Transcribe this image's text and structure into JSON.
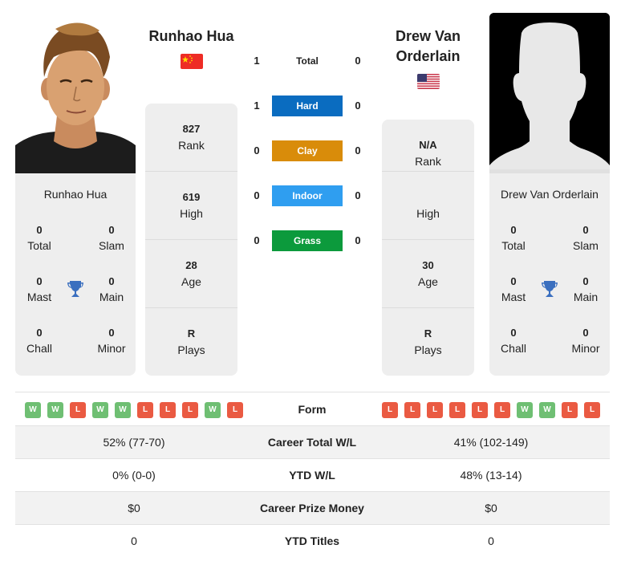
{
  "player1": {
    "name": "Runhao Hua",
    "country_flag": "china-flag",
    "photo": "player-photo",
    "card_name": "Runhao Hua",
    "titles": {
      "total": {
        "value": "0",
        "label": "Total"
      },
      "slam": {
        "value": "0",
        "label": "Slam"
      },
      "mast": {
        "value": "0",
        "label": "Mast"
      },
      "main": {
        "value": "0",
        "label": "Main"
      },
      "chall": {
        "value": "0",
        "label": "Chall"
      },
      "minor": {
        "value": "0",
        "label": "Minor"
      }
    },
    "stats": {
      "rank": {
        "value": "827",
        "label": "Rank"
      },
      "high": {
        "value": "619",
        "label": "High"
      },
      "age": {
        "value": "28",
        "label": "Age"
      },
      "plays": {
        "value": "R",
        "label": "Plays"
      }
    },
    "form": [
      "W",
      "W",
      "L",
      "W",
      "W",
      "L",
      "L",
      "L",
      "W",
      "L"
    ]
  },
  "player2": {
    "name": "Drew Van Orderlain",
    "country_flag": "usa-flag",
    "photo": "silhouette-placeholder",
    "card_name": "Drew Van Orderlain",
    "titles": {
      "total": {
        "value": "0",
        "label": "Total"
      },
      "slam": {
        "value": "0",
        "label": "Slam"
      },
      "mast": {
        "value": "0",
        "label": "Mast"
      },
      "main": {
        "value": "0",
        "label": "Main"
      },
      "chall": {
        "value": "0",
        "label": "Chall"
      },
      "minor": {
        "value": "0",
        "label": "Minor"
      }
    },
    "stats": {
      "rank": {
        "value": "N/A",
        "label": "Rank"
      },
      "high": {
        "value": "",
        "label": "High"
      },
      "age": {
        "value": "30",
        "label": "Age"
      },
      "plays": {
        "value": "R",
        "label": "Plays"
      }
    },
    "form": [
      "L",
      "L",
      "L",
      "L",
      "L",
      "L",
      "W",
      "W",
      "L",
      "L"
    ]
  },
  "h2h": {
    "total": {
      "label": "Total",
      "p1": "1",
      "p2": "0"
    },
    "surfaces": [
      {
        "label": "Hard",
        "p1": "1",
        "p2": "0",
        "color": "#0a6cc0"
      },
      {
        "label": "Clay",
        "p1": "0",
        "p2": "0",
        "color": "#d98c0a"
      },
      {
        "label": "Indoor",
        "p1": "0",
        "p2": "0",
        "color": "#2f9ef0"
      },
      {
        "label": "Grass",
        "p1": "0",
        "p2": "0",
        "color": "#0c9a3c"
      }
    ]
  },
  "comparison": {
    "form_label": "Form",
    "rows": [
      {
        "label": "Career Total W/L",
        "p1": "52% (77-70)",
        "p2": "41% (102-149)"
      },
      {
        "label": "YTD W/L",
        "p1": "0% (0-0)",
        "p2": "48% (13-14)"
      },
      {
        "label": "Career Prize Money",
        "p1": "$0",
        "p2": "$0"
      },
      {
        "label": "YTD Titles",
        "p1": "0",
        "p2": "0"
      }
    ]
  },
  "colors": {
    "win": "#6fbf73",
    "loss": "#ea5a42",
    "trophy": "#3a6fbf",
    "card_bg": "#eeeeee"
  }
}
